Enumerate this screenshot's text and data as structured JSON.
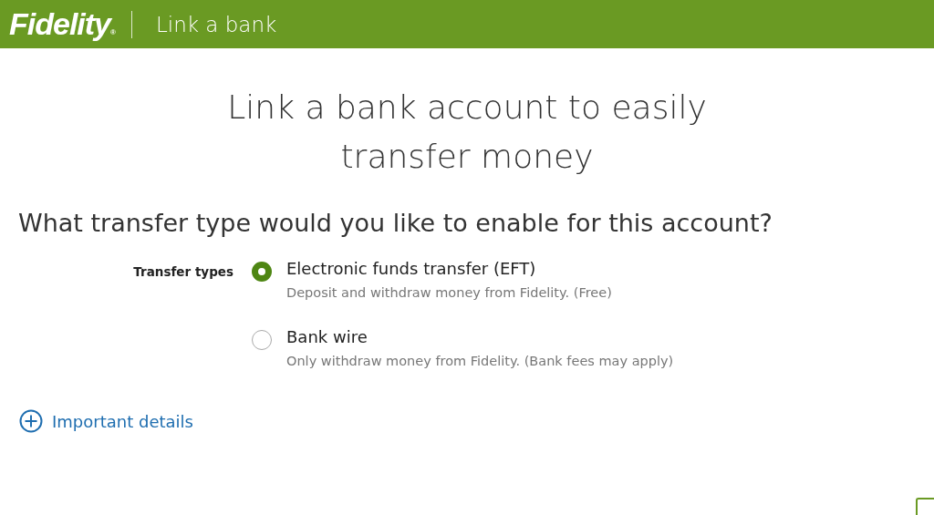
{
  "header": {
    "logo": "Fidelity",
    "mark": "®",
    "title": "Link a bank"
  },
  "heading": "Link a bank account to easily transfer money",
  "question": "What transfer type would you like to enable for this account?",
  "transfer_types": {
    "label": "Transfer types",
    "options": [
      {
        "title": "Electronic funds transfer (EFT)",
        "description": "Deposit and withdraw money from Fidelity. (Free)",
        "selected": true
      },
      {
        "title": "Bank wire",
        "description": "Only withdraw money from Fidelity. (Bank fees may apply)",
        "selected": false
      }
    ]
  },
  "details_link": "Important details"
}
